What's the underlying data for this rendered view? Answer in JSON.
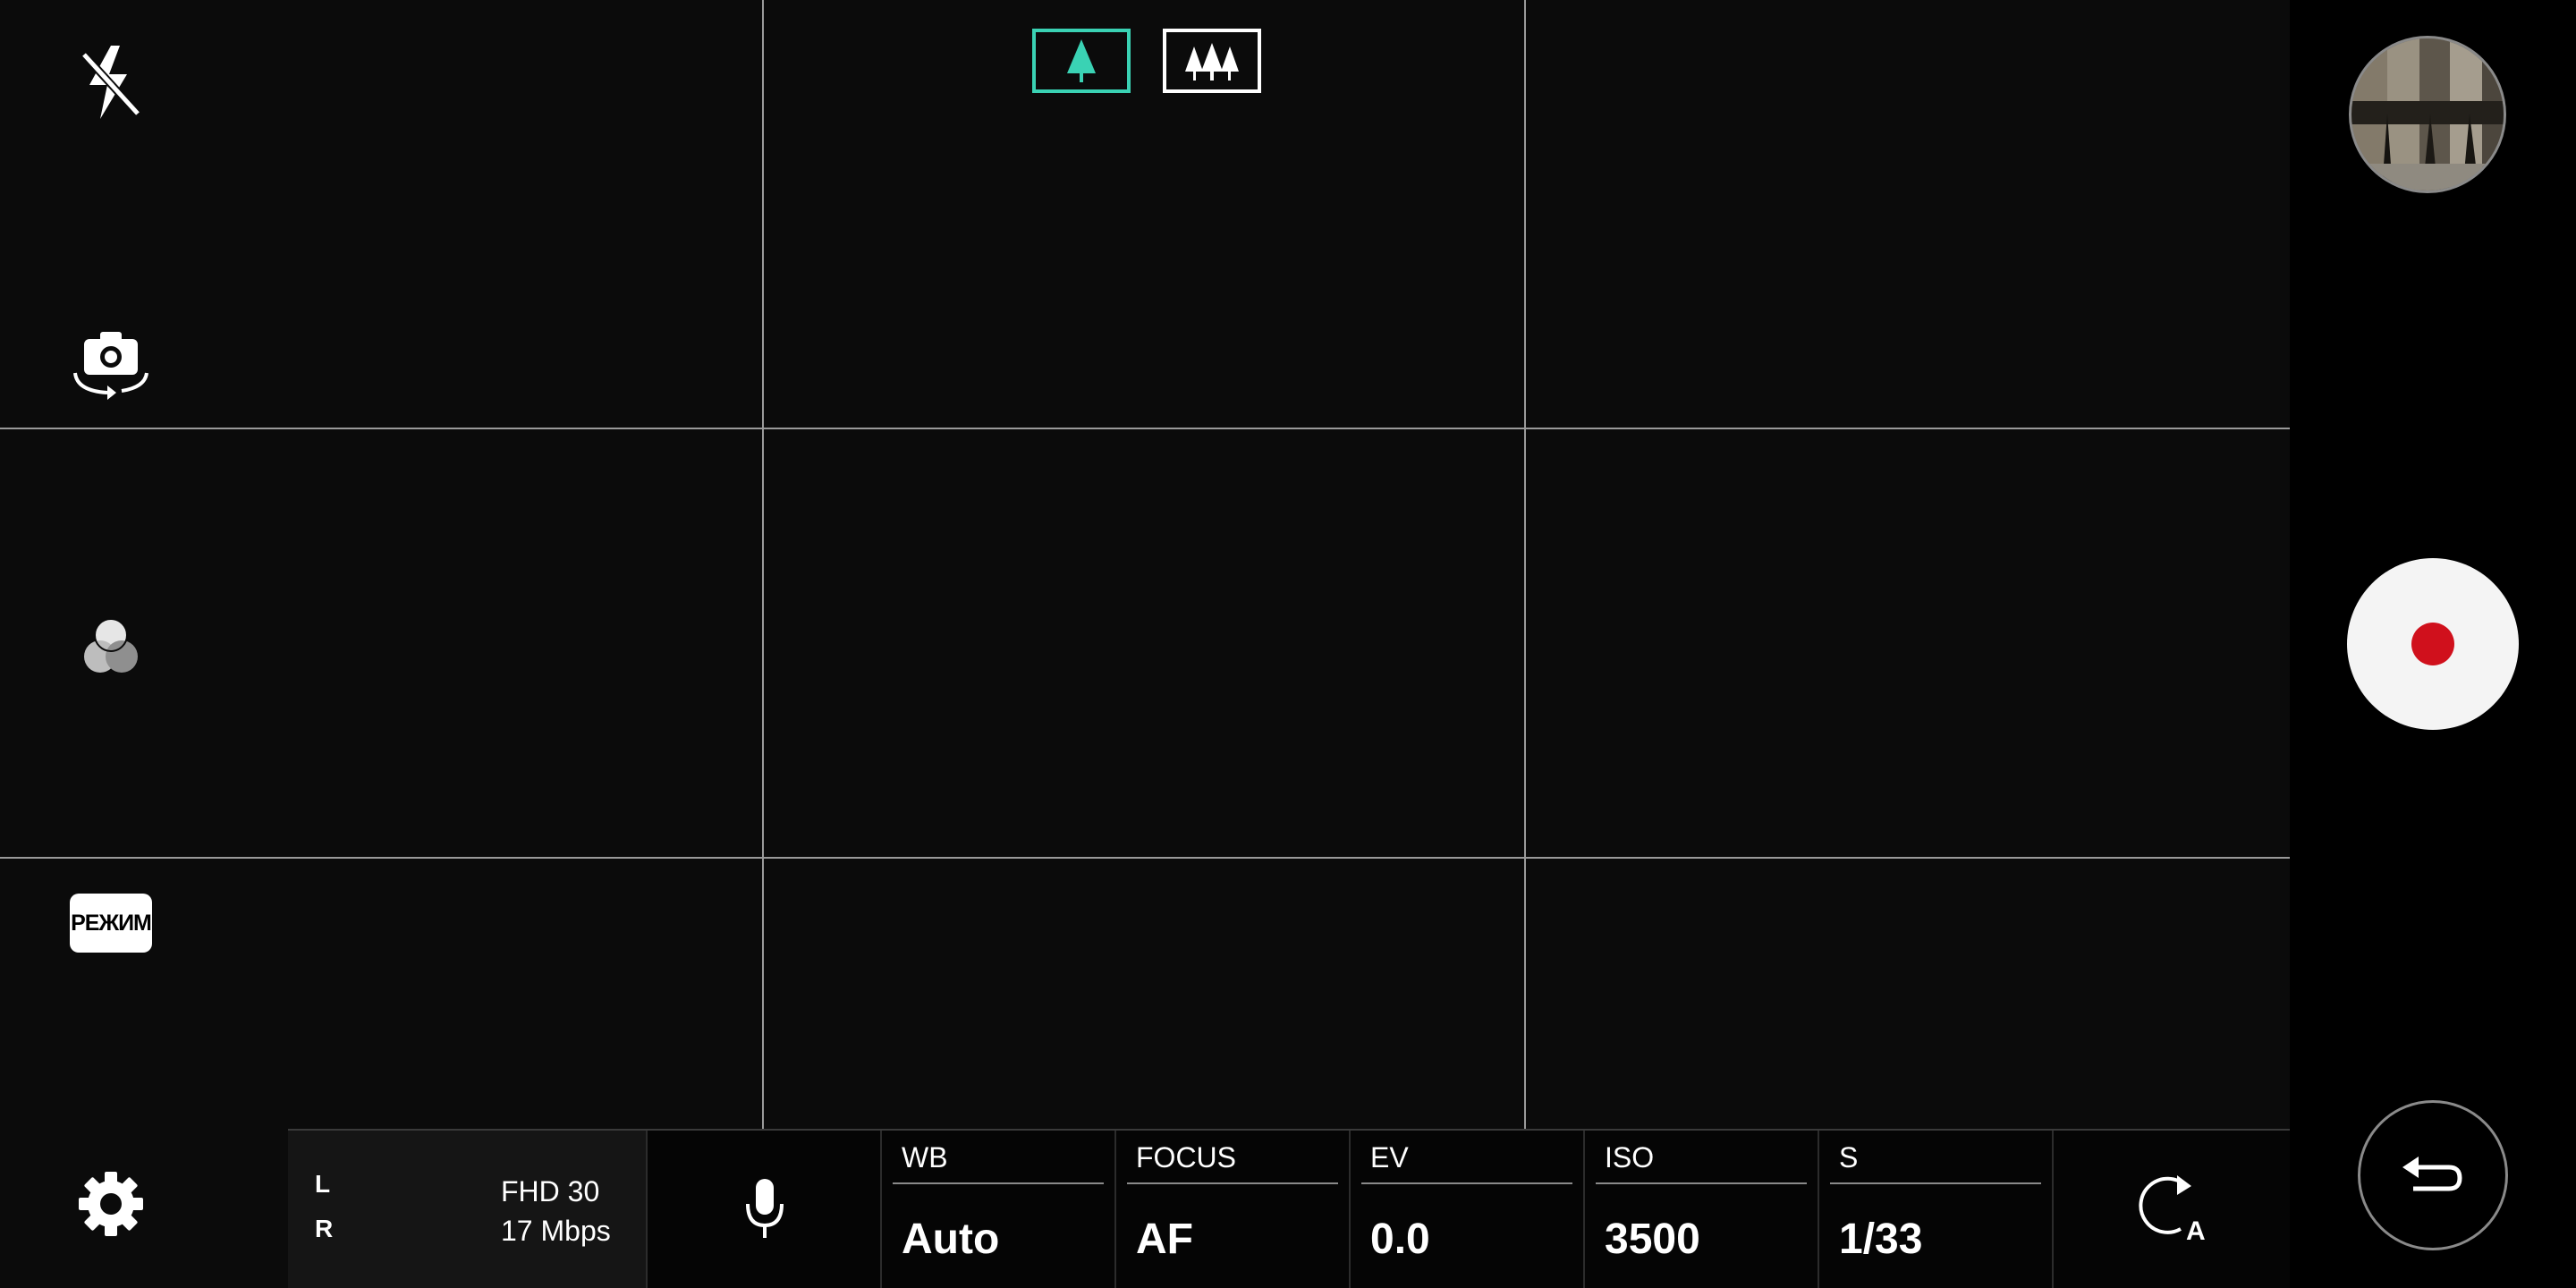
{
  "left_toolbar": {
    "flash_icon": "flash-off-icon",
    "switch_camera_icon": "camera-switch-icon",
    "filter_icon": "color-filter-icon",
    "mode_label": "РЕЖИМ",
    "settings_icon": "gear-icon"
  },
  "lens_selector": {
    "options": [
      "single-tree-icon",
      "three-trees-icon"
    ],
    "selected_index": 0,
    "selected_color": "#3ad2b4"
  },
  "bottom_bar": {
    "audio": {
      "left_channel": "L",
      "right_channel": "R",
      "resolution": "FHD 30",
      "bitrate": "17 Mbps"
    },
    "mic_icon": "microphone-icon",
    "params": [
      {
        "label": "WB",
        "value": "Auto"
      },
      {
        "label": "FOCUS",
        "value": "AF"
      },
      {
        "label": "EV",
        "value": "0.0"
      },
      {
        "label": "ISO",
        "value": "3500"
      },
      {
        "label": "S",
        "value": "1/33"
      }
    ],
    "reset_icon": "auto-reset-icon"
  },
  "right_panel": {
    "gallery_icon": "gallery-thumbnail",
    "record_icon": "record-icon",
    "record_color": "#d0101c",
    "back_icon": "back-arrow-icon"
  }
}
